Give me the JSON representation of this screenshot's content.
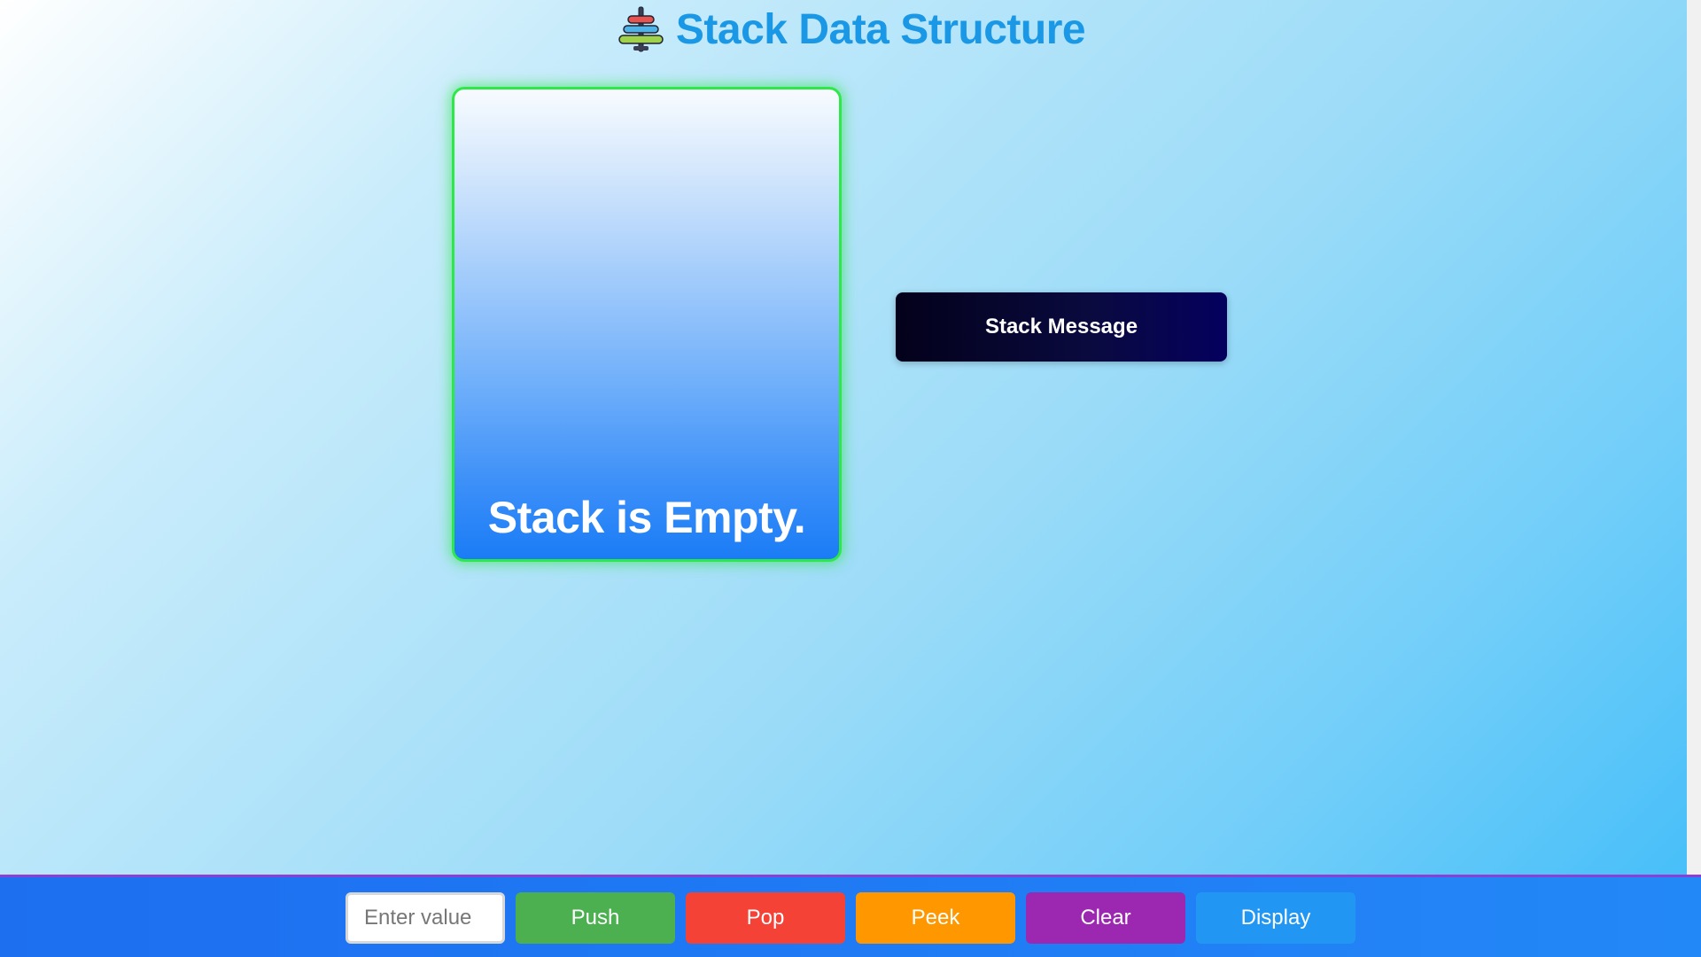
{
  "header": {
    "title": "Stack Data Structure",
    "icon": "stack-rings-icon"
  },
  "stack": {
    "empty_text": "Stack is Empty."
  },
  "message": {
    "text": "Stack Message"
  },
  "controls": {
    "input_placeholder": "Enter value",
    "input_value": "",
    "push_label": "Push",
    "pop_label": "Pop",
    "peek_label": "Peek",
    "clear_label": "Clear",
    "display_label": "Display"
  },
  "colors": {
    "title": "#1a98e6",
    "stack_border": "#2ee84a",
    "push": "#4caf50",
    "pop": "#f44336",
    "peek": "#ff9800",
    "clear": "#9c27b0",
    "display": "#2196f3",
    "message_bg": "#0a0a40"
  }
}
